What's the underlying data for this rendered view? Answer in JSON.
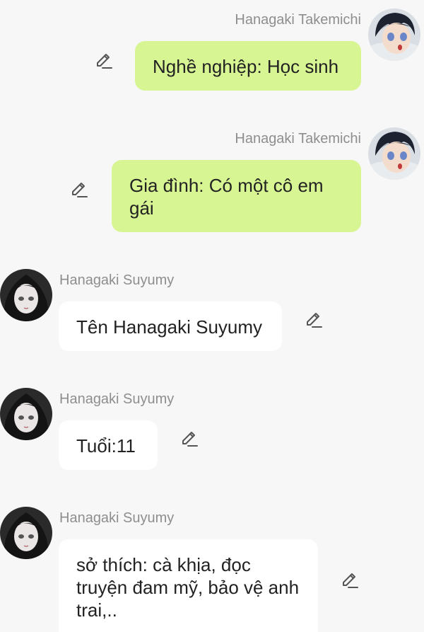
{
  "messages": [
    {
      "sender": "Hanagaki Takemichi",
      "text": "Nghề nghiệp: Học sinh",
      "side": "right"
    },
    {
      "sender": "Hanagaki Takemichi",
      "text": "Gia đình: Có một cô em gái",
      "side": "right"
    },
    {
      "sender": "Hanagaki Suyumy",
      "text": "Tên Hanagaki Suyumy",
      "side": "left"
    },
    {
      "sender": "Hanagaki Suyumy",
      "text": "Tuổi:11",
      "side": "left"
    },
    {
      "sender": "Hanagaki Suyumy",
      "text": "sở thích: cà khịa, đọc truyện đam mỹ, bảo vệ anh trai,..",
      "side": "left"
    }
  ],
  "icons": {
    "edit": "pencil-icon"
  },
  "colors": {
    "outgoing_bubble": "#d8f593",
    "incoming_bubble": "#ffffff",
    "background": "#f7f7f7",
    "name_text": "#8e8e8e"
  }
}
